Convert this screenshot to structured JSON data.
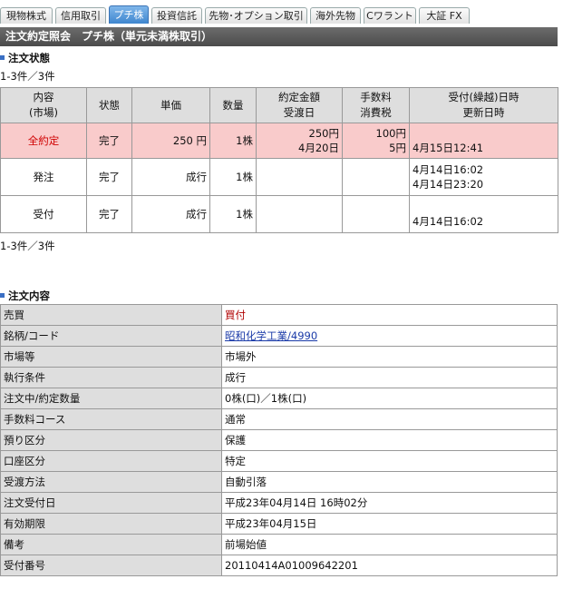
{
  "tabs": [
    "現物株式",
    "信用取引",
    "プチ株",
    "投資信託",
    "先物･オプション取引",
    "海外先物",
    "Cワラント",
    "大証 FX"
  ],
  "active_tab": 2,
  "header_title": "注文約定照会　プチ株（単元未満株取引）",
  "status_section": {
    "title": "注文状態",
    "count_top": "1-3件／3件",
    "count_bottom": "1-3件／3件"
  },
  "status_table": {
    "headers": {
      "naiyo": [
        "内容",
        "(市場)"
      ],
      "jotai": "状態",
      "tanka": "単価",
      "suryo": "数量",
      "kingaku": [
        "約定金額",
        "受渡日"
      ],
      "tesuryo": [
        "手数料",
        "消費税"
      ],
      "uketsuke": [
        "受付(繰越)日時",
        "更新日時"
      ]
    },
    "rows": [
      {
        "naiyo": "全約定",
        "jotai": "完了",
        "tanka": "250 円",
        "suryo": "1株",
        "kingaku": [
          "250円",
          "4月20日"
        ],
        "tesuryo": [
          "100円",
          "5円"
        ],
        "uketsuke": [
          "",
          "4月15日12:41"
        ]
      },
      {
        "naiyo": "発注",
        "jotai": "完了",
        "tanka": "成行",
        "suryo": "1株",
        "kingaku": [
          "",
          ""
        ],
        "tesuryo": [
          "",
          ""
        ],
        "uketsuke": [
          "4月14日16:02",
          "4月14日23:20"
        ]
      },
      {
        "naiyo": "受付",
        "jotai": "完了",
        "tanka": "成行",
        "suryo": "1株",
        "kingaku": [
          "",
          ""
        ],
        "tesuryo": [
          "",
          ""
        ],
        "uketsuke": [
          "",
          "4月14日16:02"
        ]
      }
    ]
  },
  "detail_section": {
    "title": "注文内容"
  },
  "detail": [
    {
      "key": "売買",
      "value": "買付"
    },
    {
      "key": "銘柄/コード",
      "value": "昭和化学工業/4990"
    },
    {
      "key": "市場等",
      "value": "市場外"
    },
    {
      "key": "執行条件",
      "value": "成行"
    },
    {
      "key": "注文中/約定数量",
      "value": "0株(口)／1株(口)"
    },
    {
      "key": "手数料コース",
      "value": "通常"
    },
    {
      "key": "預り区分",
      "value": "保護"
    },
    {
      "key": "口座区分",
      "value": "特定"
    },
    {
      "key": "受渡方法",
      "value": "自動引落"
    },
    {
      "key": "注文受付日",
      "value": "平成23年04月14日 16時02分"
    },
    {
      "key": "有効期限",
      "value": "平成23年04月15日"
    },
    {
      "key": "備考",
      "value": "前場始値"
    },
    {
      "key": "受付番号",
      "value": "20110414A01009642201"
    }
  ]
}
